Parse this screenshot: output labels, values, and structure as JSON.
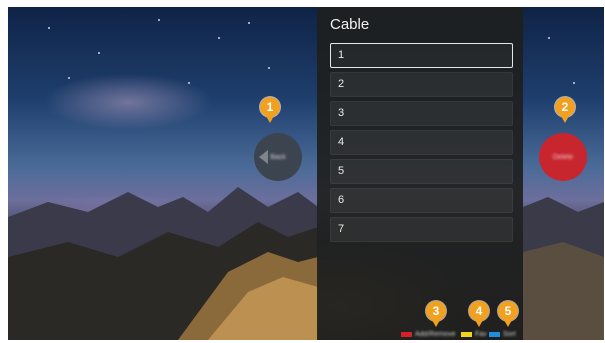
{
  "panel": {
    "title": "Cable",
    "channels": [
      "1",
      "2",
      "3",
      "4",
      "5",
      "6",
      "7"
    ],
    "selected_index": 0
  },
  "buttons": {
    "back": {
      "label": "Back",
      "icon": "back-arrow-icon",
      "color": "#3c4450"
    },
    "delete": {
      "label": "Delete",
      "icon": "delete-icon",
      "color": "#c8262f"
    }
  },
  "markers": [
    "1",
    "2",
    "3",
    "4",
    "5"
  ],
  "color_keys": [
    {
      "color": "#d8202a",
      "label": "Add/Remove"
    },
    {
      "color": "#f2d21a",
      "label": "Fav"
    },
    {
      "color": "#1f8de0",
      "label": "Sort"
    }
  ],
  "marker_color": "#f2a020"
}
